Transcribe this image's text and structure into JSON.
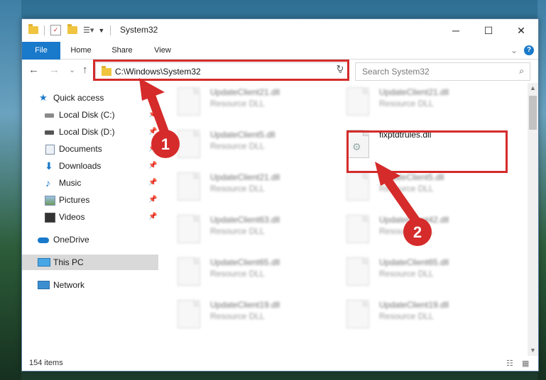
{
  "window": {
    "title": "System32",
    "minimize": "─",
    "maximize": "☐",
    "close": "✕"
  },
  "ribbon": {
    "tabs": [
      "File",
      "Home",
      "Share",
      "View"
    ],
    "expand": "⌄",
    "help": "?"
  },
  "nav": {
    "back": "←",
    "forward": "→",
    "recent": "⌄",
    "up": "↑",
    "address": "C:\\Windows\\System32",
    "address_dropdown": "⌄",
    "refresh": "↻",
    "search_placeholder": "Search System32",
    "search_icon": "⌕"
  },
  "sidebar": {
    "items": [
      {
        "label": "Quick access",
        "icon": "star-icon",
        "pinned": false
      },
      {
        "label": "Local Disk (C:)",
        "icon": "drive-icon",
        "pinned": true
      },
      {
        "label": "Local Disk (D:)",
        "icon": "drive-icon",
        "pinned": true
      },
      {
        "label": "Documents",
        "icon": "documents-icon",
        "pinned": true
      },
      {
        "label": "Downloads",
        "icon": "downloads-icon",
        "pinned": true
      },
      {
        "label": "Music",
        "icon": "music-icon",
        "pinned": true
      },
      {
        "label": "Pictures",
        "icon": "pictures-icon",
        "pinned": true
      },
      {
        "label": "Videos",
        "icon": "videos-icon",
        "pinned": true
      },
      {
        "label": "OneDrive",
        "icon": "onedrive-icon",
        "pinned": false
      },
      {
        "label": "This PC",
        "icon": "pc-icon",
        "pinned": false
      },
      {
        "label": "Network",
        "icon": "network-icon",
        "pinned": false
      }
    ],
    "pin_glyph": "📌"
  },
  "files": {
    "items": [
      {
        "name": "UpdateClient21.dll",
        "type": "Resource DLL"
      },
      {
        "name": "UpdateClient21.dll",
        "type": "Resource DLL"
      },
      {
        "name": "UpdateClient5.dll",
        "type": "Resource DLL"
      },
      {
        "name": "fixptdtrules.dll",
        "type": ""
      },
      {
        "name": "UpdateClient21.dll",
        "type": "Resource DLL"
      },
      {
        "name": "UpdateClient5.dll",
        "type": "Resource DLL"
      },
      {
        "name": "UpdateClient63.dll",
        "type": "Resource DLL"
      },
      {
        "name": "UpdateClient42.dll",
        "type": "Resource DLL"
      },
      {
        "name": "UpdateClient65.dll",
        "type": "Resource DLL"
      },
      {
        "name": "UpdateClient65.dll",
        "type": "Resource DLL"
      },
      {
        "name": "UpdateClient19.dll",
        "type": "Resource DLL"
      },
      {
        "name": "UpdateClient19.dll",
        "type": "Resource DLL"
      }
    ]
  },
  "annotations": {
    "step1": "1",
    "step2": "2",
    "color": "#d52b2b"
  },
  "status": {
    "item_count": "154 items"
  },
  "colors": {
    "file_tab": "#1979ca",
    "highlight": "#d52b2b",
    "selected_nav": "#d9d9d9"
  }
}
